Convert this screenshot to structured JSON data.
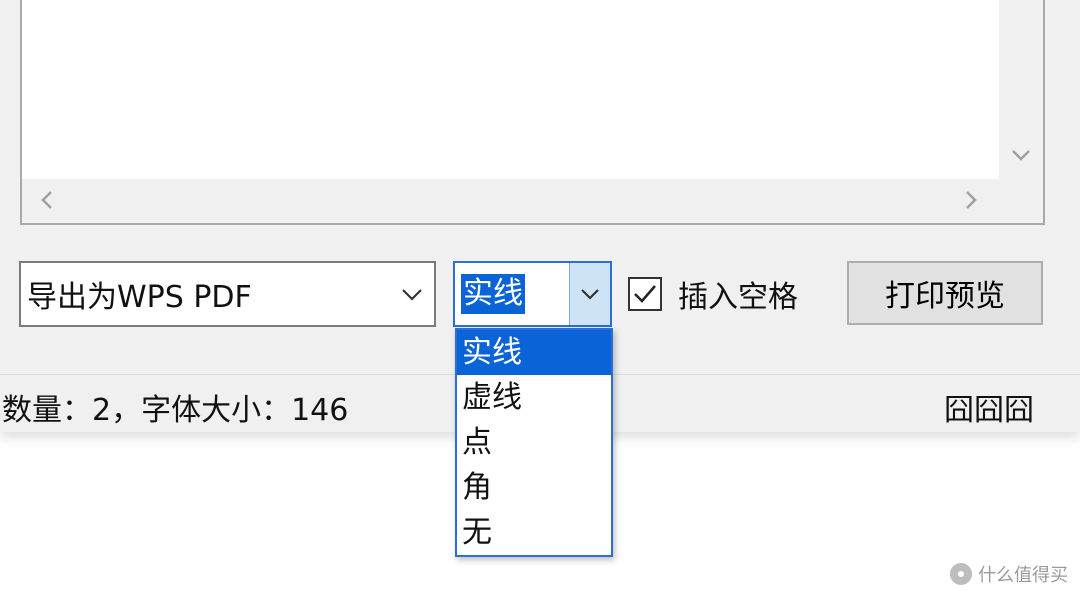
{
  "export_select": {
    "value": "导出为WPS PDF"
  },
  "line_combo": {
    "value": "实线"
  },
  "line_options": [
    "实线",
    "虚线",
    "点",
    "角",
    "无"
  ],
  "checkbox": {
    "label": "插入空格",
    "checked": true
  },
  "preview_button": {
    "label": "打印预览"
  },
  "status": {
    "text": "数量：2，字体大小：146",
    "right": "囧囧囧"
  },
  "watermark": {
    "text": "什么值得买"
  },
  "colors": {
    "accent": "#0a64d8",
    "dialog_bg": "#f0f0f0"
  }
}
